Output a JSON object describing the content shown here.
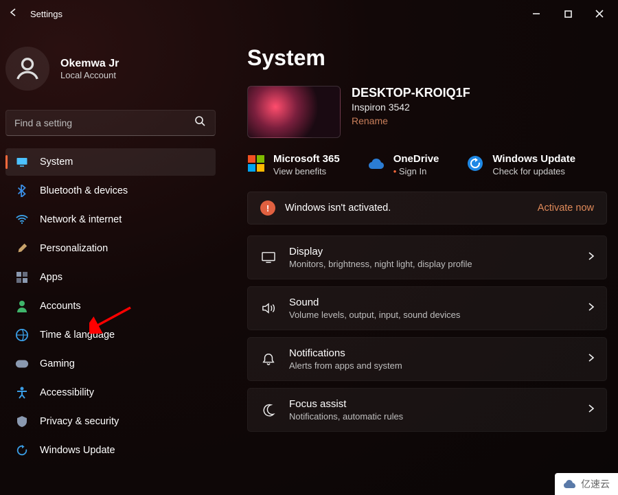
{
  "window": {
    "title": "Settings"
  },
  "user": {
    "name": "Okemwa Jr",
    "subtitle": "Local Account"
  },
  "search": {
    "placeholder": "Find a setting"
  },
  "sidebar": {
    "items": [
      {
        "label": "System",
        "icon": "monitor-icon",
        "selected": true,
        "color": "#4cc2ff"
      },
      {
        "label": "Bluetooth & devices",
        "icon": "bluetooth-icon",
        "selected": false,
        "color": "#3a8ee6"
      },
      {
        "label": "Network & internet",
        "icon": "wifi-icon",
        "selected": false,
        "color": "#3aa0e6"
      },
      {
        "label": "Personalization",
        "icon": "brush-icon",
        "selected": false,
        "color": "#c9a36b"
      },
      {
        "label": "Apps",
        "icon": "apps-icon",
        "selected": false,
        "color": "#8a99b0"
      },
      {
        "label": "Accounts",
        "icon": "person-icon",
        "selected": false,
        "color": "#3fb56b"
      },
      {
        "label": "Time & language",
        "icon": "globe-clock-icon",
        "selected": false,
        "color": "#3a9ee6"
      },
      {
        "label": "Gaming",
        "icon": "gamepad-icon",
        "selected": false,
        "color": "#8a99b0"
      },
      {
        "label": "Accessibility",
        "icon": "accessibility-icon",
        "selected": false,
        "color": "#3a9ee6"
      },
      {
        "label": "Privacy & security",
        "icon": "shield-icon",
        "selected": false,
        "color": "#8a99b0"
      },
      {
        "label": "Windows Update",
        "icon": "update-icon",
        "selected": false,
        "color": "#3a9ee6"
      }
    ]
  },
  "page": {
    "title": "System"
  },
  "device": {
    "name": "DESKTOP-KROIQ1F",
    "model": "Inspiron 3542",
    "rename": "Rename"
  },
  "quick": {
    "m365": {
      "title": "Microsoft 365",
      "sub": "View benefits"
    },
    "onedrive": {
      "title": "OneDrive",
      "sub": "Sign In"
    },
    "update": {
      "title": "Windows Update",
      "sub": "Check for updates"
    }
  },
  "banner": {
    "text": "Windows isn't activated.",
    "action": "Activate now"
  },
  "cards": [
    {
      "title": "Display",
      "sub": "Monitors, brightness, night light, display profile",
      "icon": "display-icon"
    },
    {
      "title": "Sound",
      "sub": "Volume levels, output, input, sound devices",
      "icon": "sound-icon"
    },
    {
      "title": "Notifications",
      "sub": "Alerts from apps and system",
      "icon": "bell-icon"
    },
    {
      "title": "Focus assist",
      "sub": "Notifications, automatic rules",
      "icon": "moon-icon"
    }
  ],
  "watermark": "亿速云",
  "annotation": {
    "target": "Accounts"
  }
}
